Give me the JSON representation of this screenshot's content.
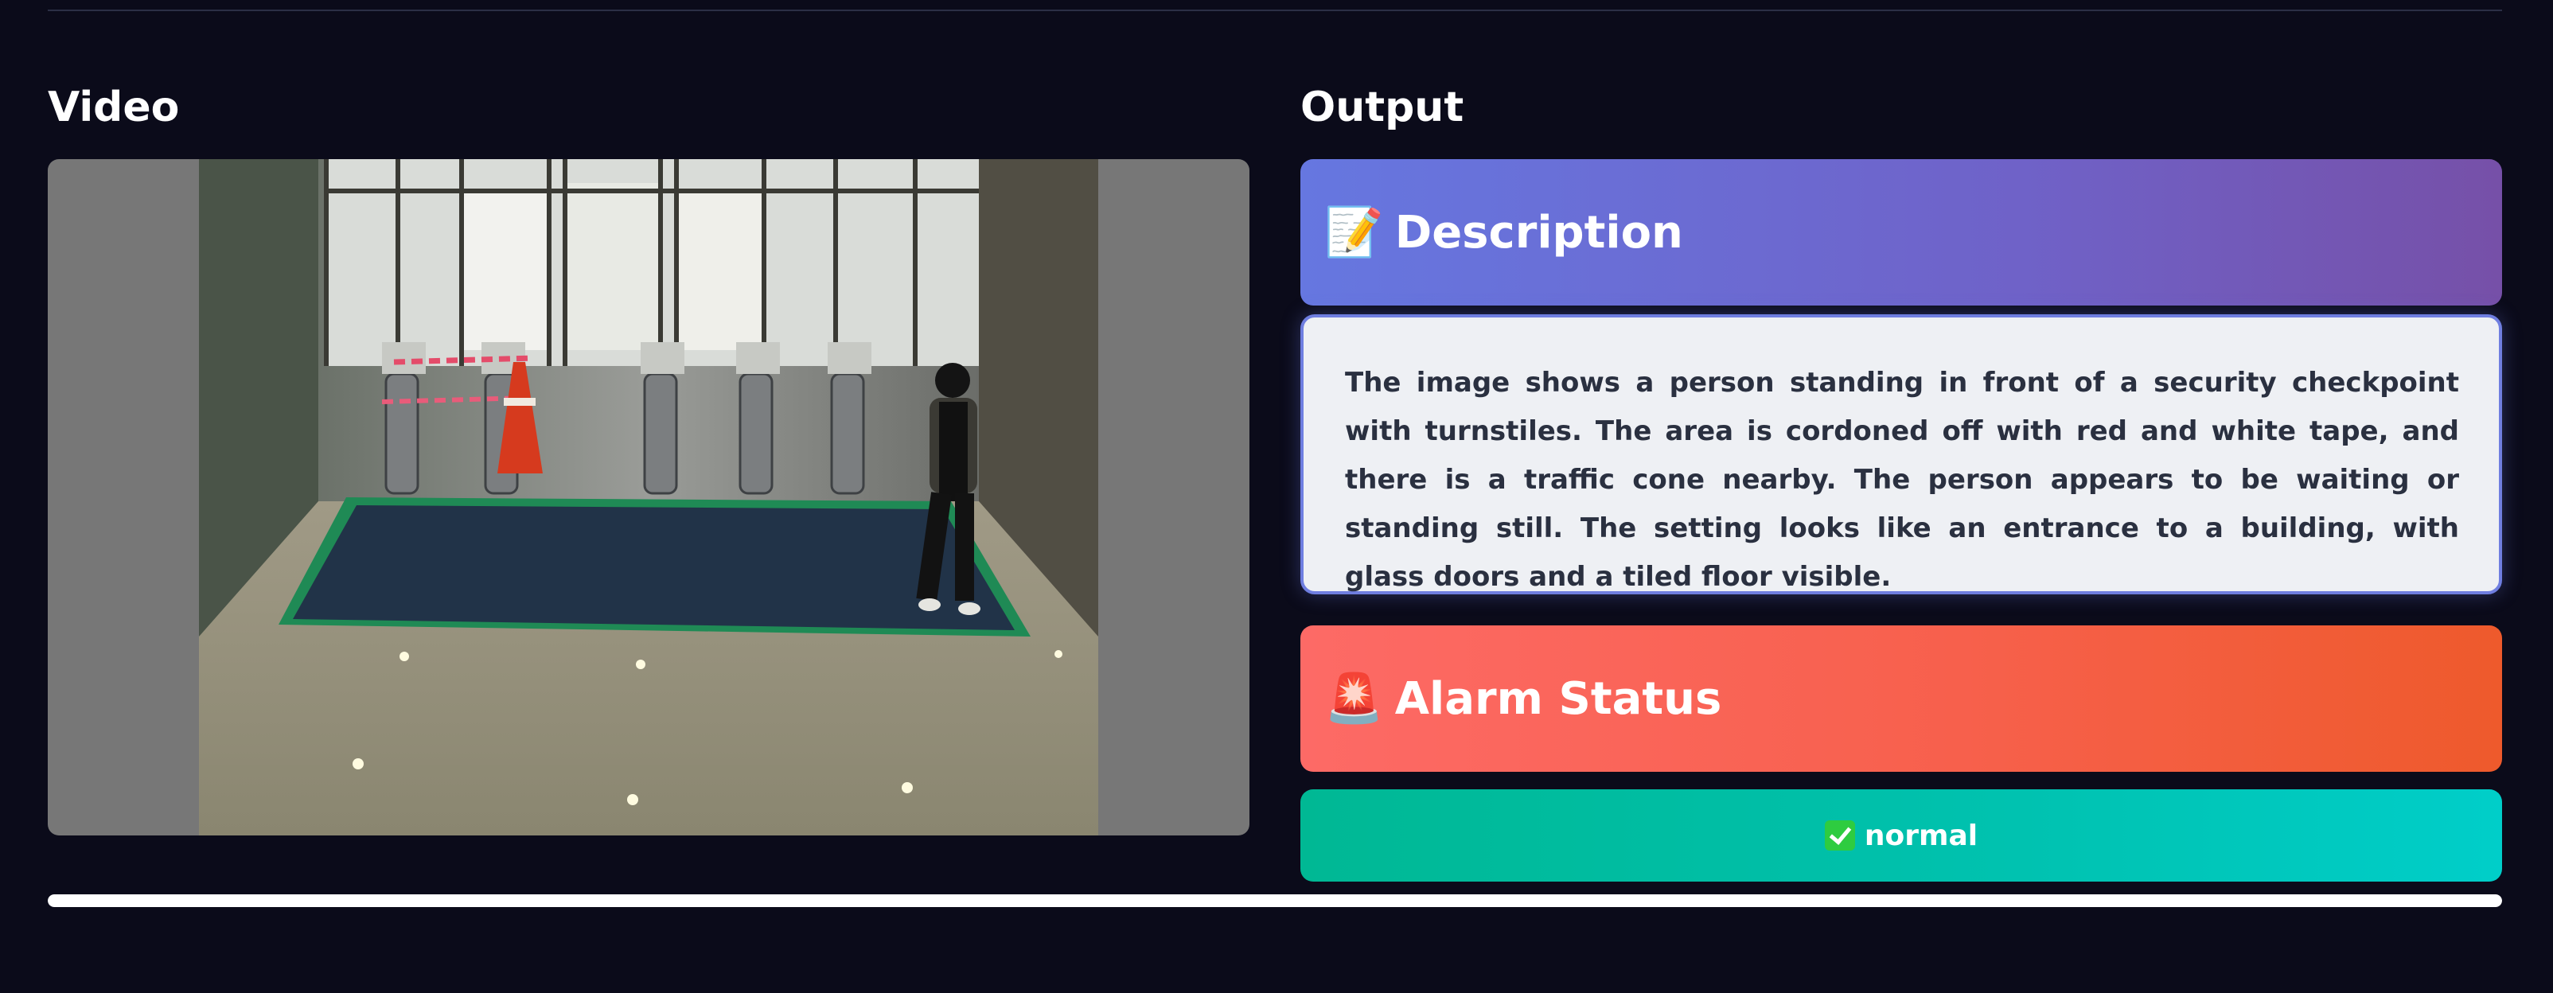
{
  "video": {
    "title": "Video"
  },
  "output": {
    "title": "Output",
    "description": {
      "icon": "memo-icon",
      "emoji": "📝",
      "label": "Description",
      "text": "The image shows a person standing in front of a security checkpoint with turnstiles. The area is cordoned off with red and white tape, and there is a traffic cone nearby. The person appears to be waiting or standing still. The setting looks like an entrance to a building, with glass doors and a tiled floor visible."
    },
    "alarm": {
      "icon": "siren-icon",
      "emoji": "🚨",
      "label": "Alarm Status",
      "status_icon": "check-mark-icon",
      "status": "normal"
    }
  },
  "progress": {
    "value": 1.0
  },
  "colors": {
    "background": "#0b0b1a",
    "description_accent": "#6677e0",
    "alarm_accent": "#f7604c",
    "status_accent": "#00b894"
  }
}
